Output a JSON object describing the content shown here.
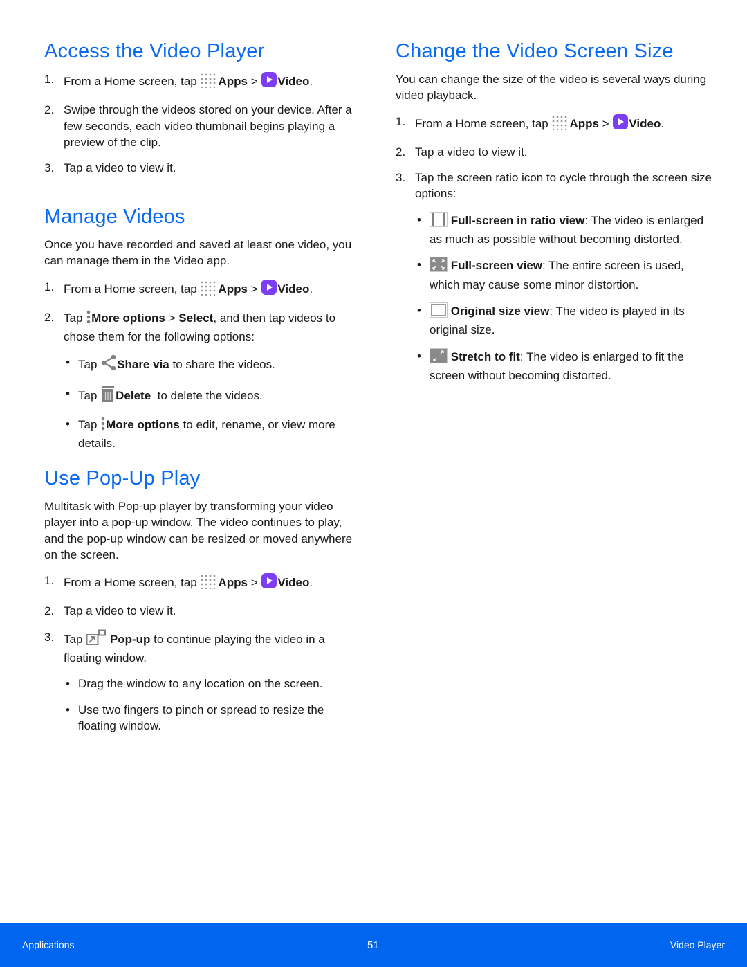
{
  "colors": {
    "heading": "#0a6af2",
    "footer_bg": "#0066f0",
    "video_icon": "#7c3ef0",
    "icon_gray": "#808080"
  },
  "icons": {
    "apps": "apps-grid-icon",
    "video": "video-app-icon",
    "more_options": "more-options-icon",
    "share": "share-icon",
    "delete": "trash-icon",
    "popup": "popup-icon",
    "ratio_view": "full-screen-ratio-icon",
    "full_screen": "full-screen-icon",
    "original_size": "original-size-icon",
    "stretch": "stretch-to-fit-icon"
  },
  "access": {
    "title": "Access the Video Player",
    "steps": [
      {
        "num": "1.",
        "pre": "From a Home screen, tap ",
        "apps": "Apps",
        "sep": " > ",
        "video": "Video",
        "post": "."
      },
      {
        "num": "2.",
        "text": "Swipe through the videos stored on your device. After a few seconds, each video thumbnail begins playing a preview of the clip."
      },
      {
        "num": "3.",
        "text": "Tap a video to view it."
      }
    ]
  },
  "manage": {
    "title": "Manage Videos",
    "intro": "Once you have recorded and saved at least one video, you can manage them in the Video app.",
    "steps": [
      {
        "num": "1.",
        "pre": "From a Home screen, tap ",
        "apps": "Apps",
        "sep": " > ",
        "video": "Video",
        "post": "."
      },
      {
        "num": "2.",
        "pre": "Tap ",
        "more": "More options",
        "sep": " > ",
        "select": "Select",
        "post": ", and then tap videos to chose them for the following options:"
      }
    ],
    "bullets": [
      {
        "dot": "•",
        "pre": "Tap ",
        "bold": "Share via",
        "post": " to share the videos."
      },
      {
        "dot": "•",
        "pre": "Tap ",
        "bold": "Delete",
        "post": "  to delete the videos."
      },
      {
        "dot": "•",
        "pre": "Tap ",
        "bold": "More options",
        "post": " to edit, rename, or view more details."
      }
    ]
  },
  "popup": {
    "title": "Use Pop-Up Play",
    "intro": "Multitask with Pop-up player by transforming your video player into a pop-up window. The video continues to play, and the pop-up window can be resized or moved anywhere on the screen.",
    "steps": [
      {
        "num": "1.",
        "pre": "From a Home screen, tap ",
        "apps": "Apps",
        "sep": " > ",
        "video": "Video",
        "post": "."
      },
      {
        "num": "2.",
        "text": "Tap a video to view it."
      },
      {
        "num": "3.",
        "pre": "Tap ",
        "bold": "Pop-up",
        "post": " to continue playing the video in a floating window."
      }
    ],
    "bullets": [
      {
        "dot": "•",
        "text": "Drag the window to any location on the screen."
      },
      {
        "dot": "•",
        "text": "Use two fingers to pinch or spread to resize the floating window."
      }
    ]
  },
  "screen_size": {
    "title": "Change the Video Screen Size",
    "intro": "You can change the size of the video is several ways during video playback.",
    "steps": [
      {
        "num": "1.",
        "pre": "From a Home screen, tap ",
        "apps": "Apps",
        "sep": " > ",
        "video": "Video",
        "post": "."
      },
      {
        "num": "2.",
        "text": "Tap a video to view it."
      },
      {
        "num": "3.",
        "text": "Tap the screen ratio icon to cycle through the screen size options:"
      }
    ],
    "bullets": [
      {
        "dot": "•",
        "bold": "Full-screen in ratio view",
        "post": ": The video is enlarged as much as possible without becoming distorted."
      },
      {
        "dot": "•",
        "bold": "Full-screen view",
        "post": ": The entire screen is used, which may cause some minor distortion."
      },
      {
        "dot": "•",
        "bold": "Original size view",
        "post": ": The video is played in its original size."
      },
      {
        "dot": "•",
        "bold": "Stretch to fit",
        "post": ": The video is enlarged to fit the screen without becoming distorted."
      }
    ]
  },
  "footer": {
    "left": "Applications",
    "page": "51",
    "right": "Video Player"
  }
}
